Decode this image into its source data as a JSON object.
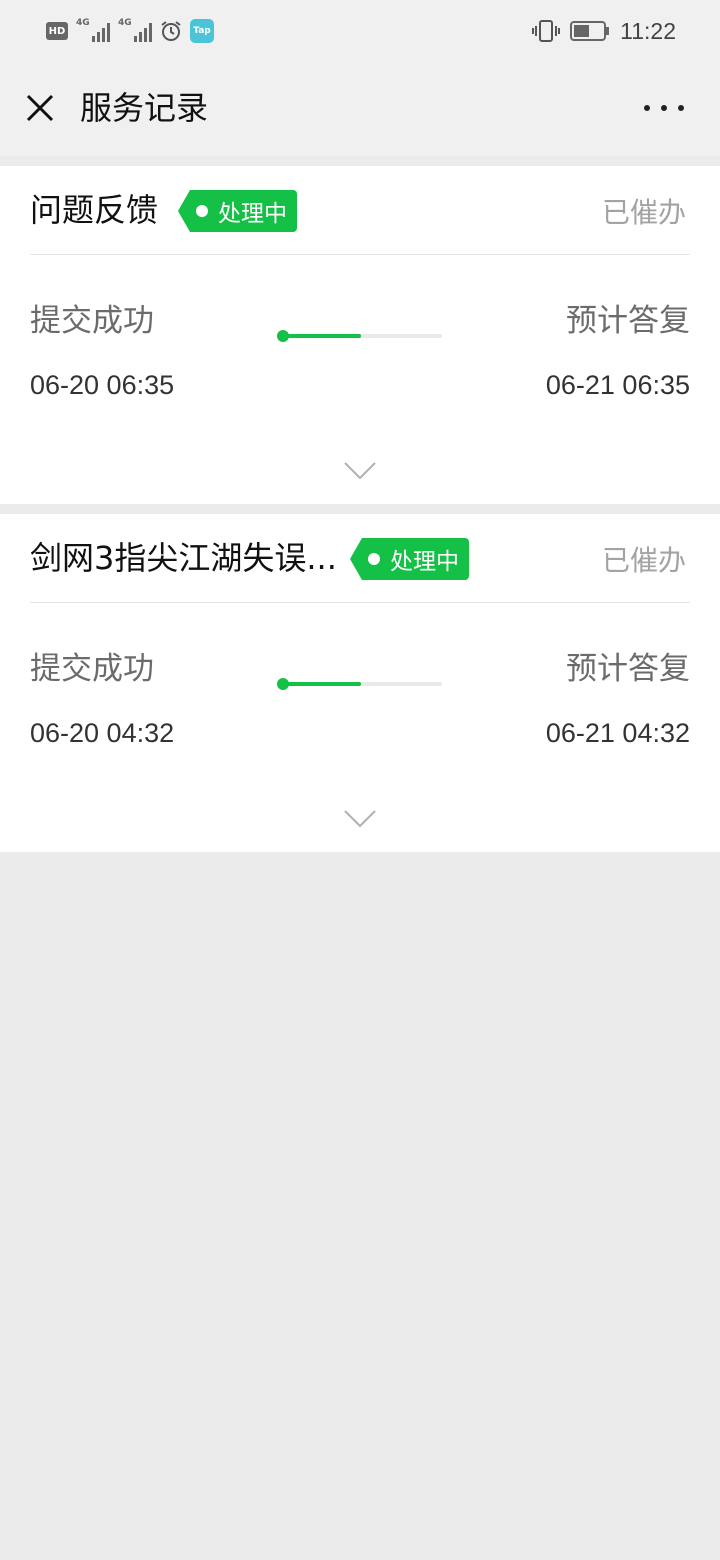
{
  "status_bar": {
    "hd_label": "HD",
    "sim1_network": "4G",
    "sim2_network": "4G",
    "tap_label": "Tap",
    "time": "11:22",
    "icons": [
      "hd-icon",
      "signal-icon",
      "signal-icon",
      "alarm-icon",
      "tap-app-icon",
      "vibrate-icon",
      "battery-icon"
    ]
  },
  "header": {
    "title": "服务记录",
    "close_icon": "close-icon",
    "more_icon": "more-icon"
  },
  "records": [
    {
      "title": "问题反馈",
      "status": "处理中",
      "urge_label": "已催办",
      "start_label": "提交成功",
      "start_time": "06-20 06:35",
      "end_label": "预计答复",
      "end_time": "06-21 06:35",
      "progress": 0.5
    },
    {
      "title": "剑网3指尖江湖失误...",
      "status": "处理中",
      "urge_label": "已催办",
      "start_label": "提交成功",
      "start_time": "06-20 04:32",
      "end_label": "预计答复",
      "end_time": "06-21 04:32",
      "progress": 0.5
    }
  ],
  "colors": {
    "accent_green": "#15c046",
    "page_background": "#ebebeb",
    "header_background": "#f0f0f0",
    "card_background": "#ffffff",
    "muted_text": "#a3a3a3"
  }
}
